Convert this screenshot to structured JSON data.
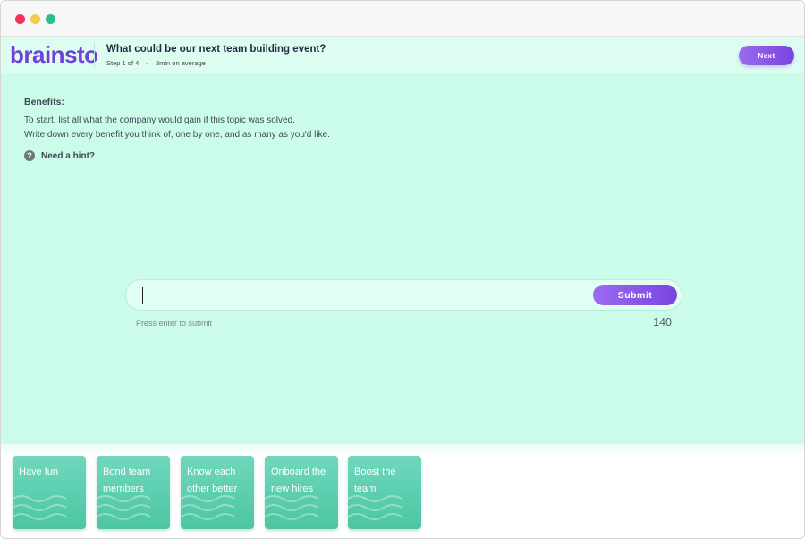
{
  "app": {
    "logo_text": "brainsto",
    "topic_title": "What could be our next team building event?",
    "step_label": "Step 1 of 4",
    "separator": "-",
    "duration_label": "3min on average",
    "next_label": "Next"
  },
  "prompt": {
    "title": "Benefits:",
    "line1": "To start, list all what the company would gain if this topic was solved.",
    "line2": "Write down every benefit you think of, one by one, and as many as you'd like.",
    "hint_icon": "?",
    "hint_label": "Need a hint?"
  },
  "input": {
    "value": "",
    "submit_label": "Submit",
    "helper_text": "Press enter to submit",
    "char_count": "140"
  },
  "ideas": [
    {
      "text": "Have fun"
    },
    {
      "text": "Bond team members"
    },
    {
      "text": "Know each other better"
    },
    {
      "text": "Onboard the new hires"
    },
    {
      "text": "Boost the team"
    }
  ],
  "colors": {
    "brand_purple": "#7a44e0",
    "main_bg": "#cafce9",
    "card_green": "#4cc5a2"
  },
  "icons": {
    "window_controls": [
      "close-dot-icon",
      "minimize-dot-icon",
      "maximize-dot-icon"
    ],
    "hint": "question-circle-icon",
    "card_decoration": "wave-lines-icon"
  }
}
